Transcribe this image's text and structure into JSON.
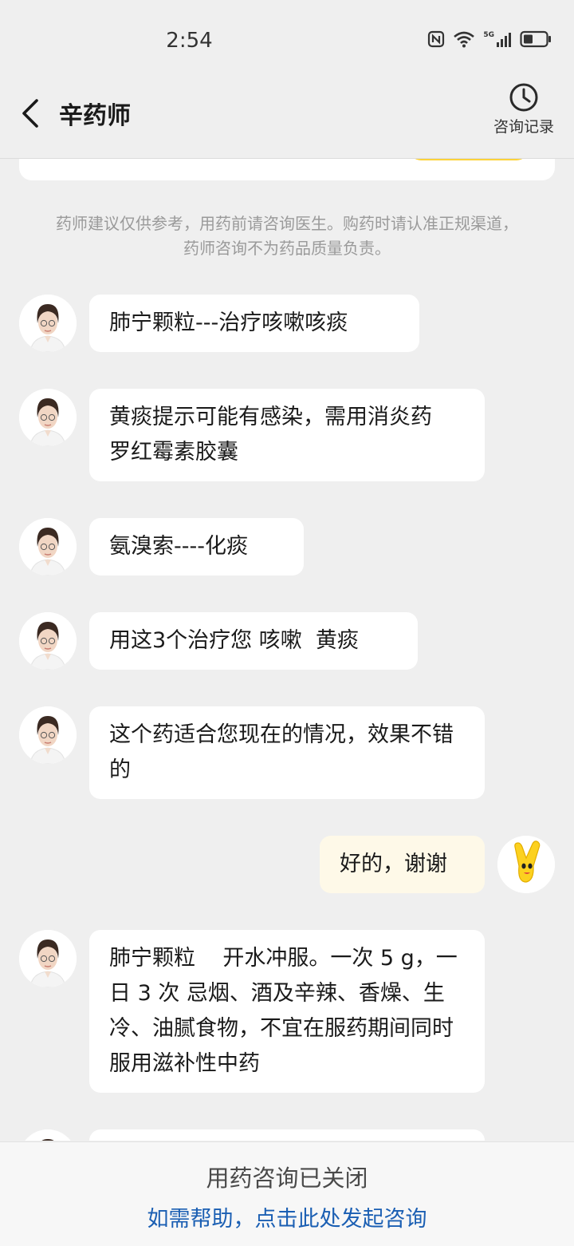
{
  "status_bar": {
    "time": "2:54",
    "network": "5G"
  },
  "header": {
    "title": "辛药师",
    "history_label": "咨询记录"
  },
  "chat": {
    "notice": "药师建议仅供参考，用药前请咨询医生。购药时请认准正规渠道，药师咨询不为药品质量负责。",
    "messages": [
      {
        "sender": "pharmacist",
        "text": "肺宁颗粒---治疗咳嗽咳痰"
      },
      {
        "sender": "pharmacist",
        "text": "黄痰提示可能有感染，需用消炎药  罗红霉素胶囊"
      },
      {
        "sender": "pharmacist",
        "text": "氨溴索----化痰"
      },
      {
        "sender": "pharmacist",
        "text": "用这3个治疗您 咳嗽  黄痰"
      },
      {
        "sender": "pharmacist",
        "text": "这个药适合您现在的情况，效果不错的"
      },
      {
        "sender": "user",
        "text": "好的，谢谢"
      },
      {
        "sender": "pharmacist",
        "text": "肺宁颗粒    开水冲服。一次 5 g，一日 3 次 忌烟、酒及辛辣、香燥、生冷、油腻食物，不宜在服药期间同时服用滋补性中药"
      }
    ]
  },
  "footer": {
    "closed_text": "用药咨询已关闭",
    "help_link": "如需帮助，点击此处发起咨询"
  },
  "colors": {
    "background": "#efefef",
    "pharmacist_bubble": "#ffffff",
    "user_bubble": "#fef9e8",
    "link": "#1b5fb3",
    "accent": "#fcd33a"
  }
}
